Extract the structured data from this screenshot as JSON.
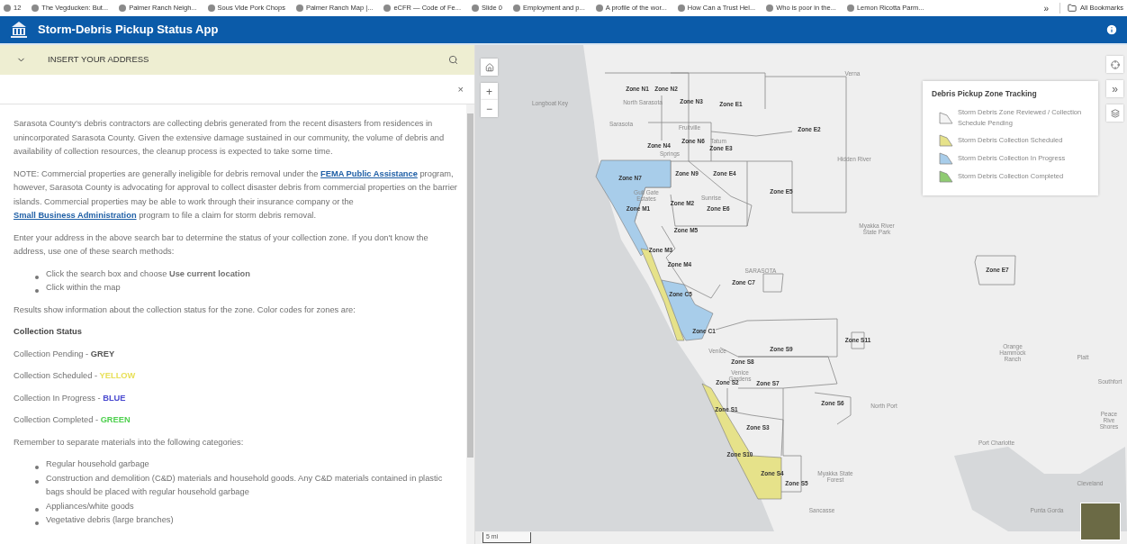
{
  "bookmarks": {
    "items": [
      "12",
      "The Vegducken: But...",
      "Palmer Ranch Neigh...",
      "Sous Vide Pork Chops",
      "Palmer Ranch Map |...",
      "eCFR — Code of Fe...",
      "Slide 0",
      "Employment and p...",
      "A profile of the wor...",
      "How Can a Trust Hel...",
      "Who is poor in the...",
      "Lemon Ricotta Parm..."
    ],
    "more": "»",
    "all": "All Bookmarks"
  },
  "header": {
    "title": "Storm-Debris Pickup Status App"
  },
  "search": {
    "title": "INSERT YOUR ADDRESS",
    "clear": "×"
  },
  "content": [
    {
      "kind": "paragraph",
      "parts": [
        {
          "kind": "text",
          "text": "Sarasota County's debris contractors are collecting debris generated from the recent disasters from residences in unincorporated Sarasota County. Given the extensive damage sustained in our community, the volume of debris and availability of collection resources, the cleanup process is expected to take some time."
        }
      ]
    },
    {
      "kind": "paragraph",
      "parts": [
        {
          "kind": "text",
          "text": "NOTE: Commercial properties are generally ineligible for debris removal under the "
        },
        {
          "kind": "link",
          "text": "FEMA Public Assistance"
        },
        {
          "kind": "text",
          "text": " program, however, Sarasota County is advocating for approval to collect disaster debris from commercial properties on the barrier islands. Commercial properties may be able to work through their insurance company or the "
        },
        {
          "kind": "link",
          "text": "Small Business Administration"
        },
        {
          "kind": "text",
          "text": " program to file a claim for storm debris removal."
        }
      ]
    },
    {
      "kind": "paragraph",
      "parts": [
        {
          "kind": "text",
          "text": "Enter your address in the above search bar to determine the status of your collection zone. If you don't know the address, use one of these search methods:"
        }
      ]
    },
    {
      "kind": "list",
      "items": [
        "Click the search box and choose **Use current location**",
        "Click within the map"
      ]
    },
    {
      "kind": "paragraph",
      "parts": [
        {
          "kind": "text",
          "text": "Results show information about the collection status for the zone.  Color codes for zones are:"
        }
      ]
    },
    {
      "kind": "heading",
      "text": "Collection Status"
    },
    {
      "kind": "status",
      "label": "Collection Pending - ",
      "value": "GREY",
      "color": "#555555"
    },
    {
      "kind": "status",
      "label": "Collection Scheduled - ",
      "value": "YELLOW",
      "color": "#e8e05a"
    },
    {
      "kind": "status",
      "label": "Collection In Progress - ",
      "value": "BLUE",
      "color": "#4a4ad0"
    },
    {
      "kind": "status",
      "label": "Collection Completed - ",
      "value": "GREEN",
      "color": "#4fd04f"
    },
    {
      "kind": "paragraph",
      "parts": [
        {
          "kind": "text",
          "text": "Remember to separate materials into the following categories:"
        }
      ]
    },
    {
      "kind": "list",
      "items": [
        "Regular household garbage",
        "Construction and demolition (C&D) materials and household goods. Any C&D materials contained in plastic bags should be placed with regular household garbage",
        "Appliances/white goods",
        "Vegetative debris (large branches)"
      ]
    }
  ],
  "map": {
    "zones": [
      "Zone N1",
      "Zone N2",
      "Zone N3",
      "Zone E1",
      "Zone E2",
      "Zone N4",
      "Zone N6",
      "Zone E3",
      "Zone N9",
      "Zone E4",
      "Zone N7",
      "Zone E5",
      "Zone M2",
      "Zone M1",
      "Zone E6",
      "Zone M5",
      "Zone M3",
      "Zone M4",
      "Zone C7",
      "Zone C5",
      "Zone C1",
      "Zone S11",
      "Zone S9",
      "Zone S8",
      "Zone S2",
      "Zone S7",
      "Zone S6",
      "Zone S1",
      "Zone S3",
      "Zone S10",
      "Zone S4",
      "Zone S5",
      "Zone E7"
    ],
    "places": [
      "Longboat Key",
      "North Sarasota",
      "Sarasota",
      "Fruitville",
      "Tatum",
      "Springs",
      "Gulf Gate Estates",
      "Sunrise",
      "Verna",
      "Hidden River",
      "Myakka River State Park",
      "SARASOTA",
      "Venice",
      "Venice Gardens",
      "North Port",
      "Orange Hammock Ranch",
      "Platt",
      "Southfort",
      "Peace Rive Shores",
      "Port Charlotte",
      "Punta Gorda",
      "Cleveland",
      "Sancasse",
      "Myakka State Forest"
    ],
    "zoom_in": "+",
    "zoom_out": "−",
    "expand": "»",
    "scale": "5 mi"
  },
  "legend": {
    "title": "Debris Pickup Zone Tracking",
    "items": [
      {
        "label": "Storm Debris Zone Reviewed / Collection Schedule Pending",
        "color": "#f4f4f4"
      },
      {
        "label": "Storm Debris Collection Scheduled",
        "color": "#e6e28a"
      },
      {
        "label": "Storm Debris Collection In Progress",
        "color": "#a8cdea"
      },
      {
        "label": "Storm Debris Collection Completed",
        "color": "#8fcb72"
      }
    ]
  }
}
